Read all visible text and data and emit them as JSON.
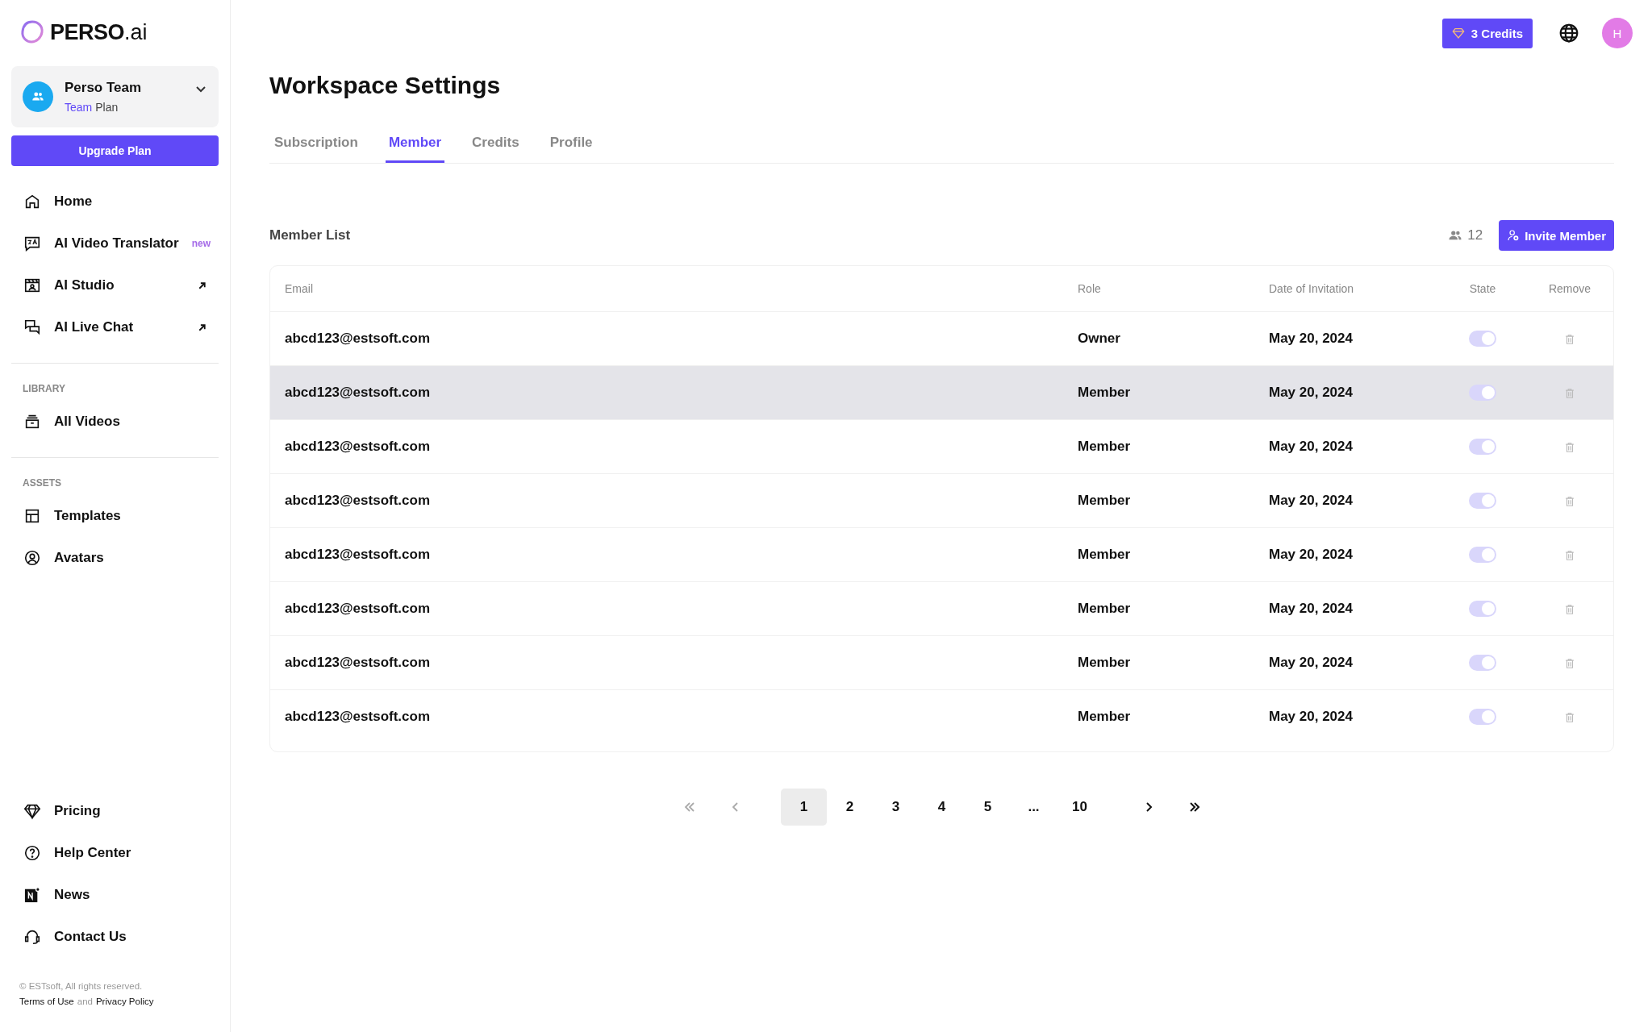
{
  "logo": {
    "brand": "PERSO",
    "suffix": ".ai"
  },
  "workspace": {
    "name": "Perso Team",
    "plan_tier": "Team",
    "plan_word": "Plan"
  },
  "upgrade_button": "Upgrade Plan",
  "nav_sections": [
    {
      "items": [
        {
          "label": "Home",
          "kind": "plain"
        },
        {
          "label": "AI Video Translator",
          "kind": "badge",
          "badge": "new"
        },
        {
          "label": "AI Studio",
          "kind": "external"
        },
        {
          "label": "AI Live Chat",
          "kind": "external"
        }
      ]
    },
    {
      "heading": "LIBRARY",
      "items": [
        {
          "label": "All Videos",
          "kind": "plain"
        }
      ]
    },
    {
      "heading": "ASSETS",
      "items": [
        {
          "label": "Templates",
          "kind": "plain"
        },
        {
          "label": "Avatars",
          "kind": "plain"
        }
      ]
    }
  ],
  "bottom_nav": [
    {
      "label": "Pricing"
    },
    {
      "label": "Help Center"
    },
    {
      "label": "News"
    },
    {
      "label": "Contact Us"
    }
  ],
  "footer": {
    "copyright": "© ESTsoft, All rights reserved.",
    "terms": "Terms of Use",
    "conjunction": "and",
    "privacy": "Privacy Policy"
  },
  "header": {
    "credits": "3 Credits",
    "avatar": "H"
  },
  "page_title": "Workspace Settings",
  "tabs": [
    {
      "label": "Subscription",
      "selected": false
    },
    {
      "label": "Member",
      "selected": true
    },
    {
      "label": "Credits",
      "selected": false
    },
    {
      "label": "Profile",
      "selected": false
    }
  ],
  "member_list": {
    "title": "Member List",
    "count": "12",
    "invite_button": "Invite Member"
  },
  "table": {
    "columns": [
      "Email",
      "Role",
      "Date of Invitation",
      "State",
      "Remove"
    ],
    "rows": [
      {
        "email": "abcd123@estsoft.com",
        "role": "Owner",
        "date": "May 20, 2024",
        "on": true,
        "selected": false
      },
      {
        "email": "abcd123@estsoft.com",
        "role": "Member",
        "date": "May 20, 2024",
        "on": true,
        "selected": true
      },
      {
        "email": "abcd123@estsoft.com",
        "role": "Member",
        "date": "May 20, 2024",
        "on": true,
        "selected": false
      },
      {
        "email": "abcd123@estsoft.com",
        "role": "Member",
        "date": "May 20, 2024",
        "on": true,
        "selected": false
      },
      {
        "email": "abcd123@estsoft.com",
        "role": "Member",
        "date": "May 20, 2024",
        "on": true,
        "selected": false
      },
      {
        "email": "abcd123@estsoft.com",
        "role": "Member",
        "date": "May 20, 2024",
        "on": true,
        "selected": false
      },
      {
        "email": "abcd123@estsoft.com",
        "role": "Member",
        "date": "May 20, 2024",
        "on": true,
        "selected": false
      },
      {
        "email": "abcd123@estsoft.com",
        "role": "Member",
        "date": "May 20, 2024",
        "on": true,
        "selected": false
      }
    ]
  },
  "pagination": {
    "first_disabled": true,
    "prev_disabled": true,
    "pages": [
      {
        "label": "1",
        "selected": true
      },
      {
        "label": "2",
        "selected": false
      },
      {
        "label": "3",
        "selected": false
      },
      {
        "label": "4",
        "selected": false
      },
      {
        "label": "5",
        "selected": false
      },
      {
        "label": "...",
        "selected": false
      },
      {
        "label": "10",
        "selected": false
      }
    ],
    "next_disabled": false,
    "last_disabled": false
  }
}
